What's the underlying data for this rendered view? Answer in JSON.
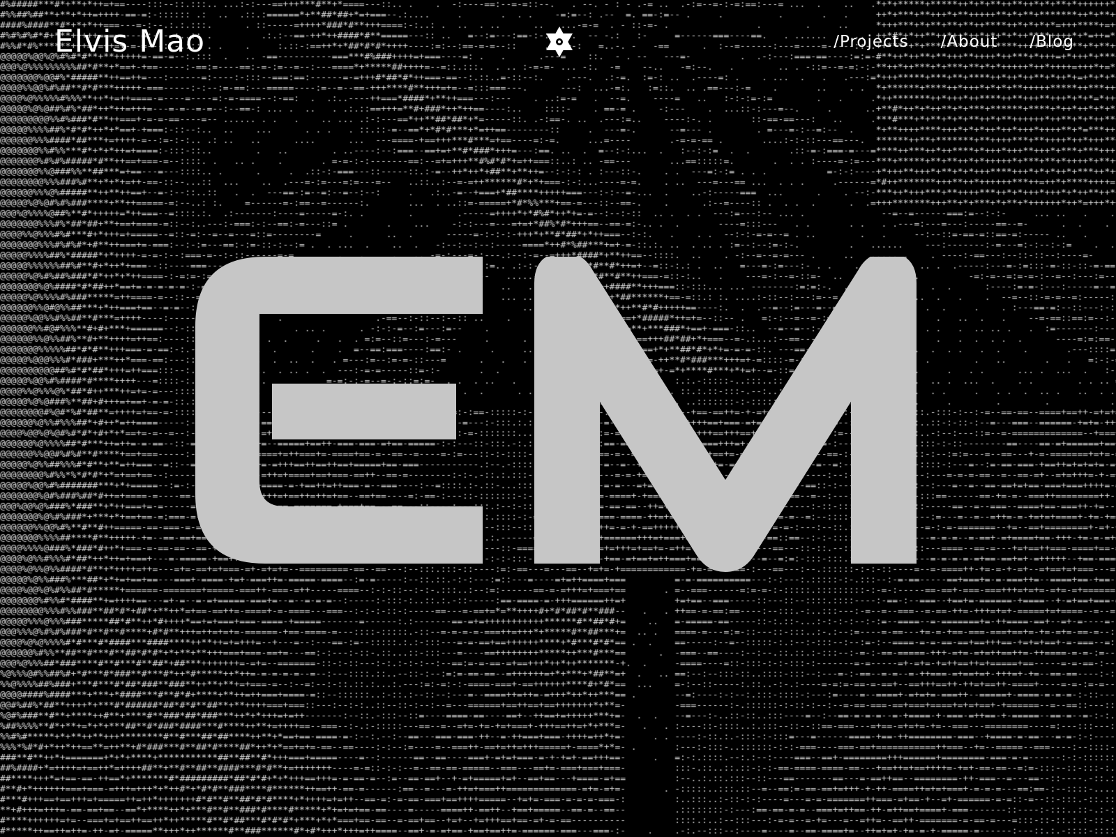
{
  "header": {
    "site_name": "Elvis Mao",
    "nav": [
      {
        "label": "/Projects"
      },
      {
        "label": "/About"
      },
      {
        "label": "/Blog"
      }
    ]
  },
  "hero": {
    "monogram": "EM",
    "monogram_color": "#c6c6c6"
  },
  "colors": {
    "background": "#000000",
    "foreground": "#ffffff",
    "ascii": "#cfcfcf"
  },
  "icons": {
    "logo": "hexagram-star-icon"
  }
}
